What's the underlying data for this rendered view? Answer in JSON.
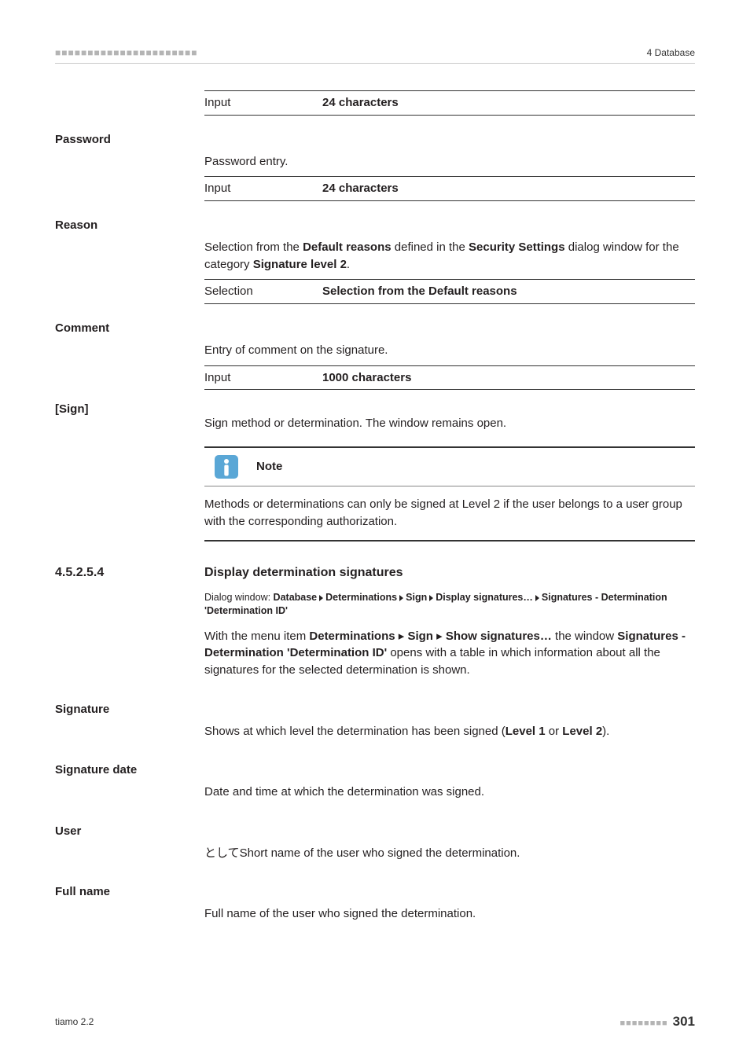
{
  "header": {
    "tick_pattern": "■■■■■■■■■■■■■■■■■■■■■■",
    "right": "4 Database"
  },
  "top_spec": {
    "key": "Input",
    "val": "24 characters"
  },
  "fields": {
    "password": {
      "label": "Password",
      "desc": "Password entry.",
      "spec_key": "Input",
      "spec_val": "24 characters"
    },
    "reason": {
      "label": "Reason",
      "desc_pre": "Selection from the ",
      "desc_bold1": "Default reasons",
      "desc_mid": " defined in the ",
      "desc_bold2": "Security Settings",
      "desc_after": " dialog window for the category ",
      "desc_bold3": "Signature level 2",
      "desc_end": ".",
      "spec_key": "Selection",
      "spec_val": "Selection from the Default reasons"
    },
    "comment": {
      "label": "Comment",
      "desc": "Entry of comment on the signature.",
      "spec_key": "Input",
      "spec_val": "1000 characters"
    },
    "sign": {
      "label": "[Sign]",
      "desc": "Sign method or determination. The window remains open."
    }
  },
  "note": {
    "title": "Note",
    "body": "Methods or determinations can only be signed at Level 2 if the user belongs to a user group with the corresponding authorization."
  },
  "section": {
    "number": "4.5.2.5.4",
    "title": "Display determination signatures",
    "dialog_prefix": "Dialog window: ",
    "dialog_parts": [
      "Database",
      "Determinations",
      "Sign",
      "Display signatures…",
      "Signatures - Determination 'Determination ID'"
    ],
    "body_pre": "With the menu item ",
    "body_bold1": "Determinations",
    "body_sep1": " ▸ ",
    "body_bold2": "Sign",
    "body_sep2": " ▸ ",
    "body_bold3": "Show signatures…",
    "body_mid": " the window ",
    "body_bold4": "Signatures - Determination 'Determination ID'",
    "body_after": " opens with a table in which information about all the signatures for the selected determination is shown."
  },
  "bottom_fields": {
    "signature": {
      "label": "Signature",
      "pre": "Shows at which level the determination has been signed (",
      "b1": "Level 1",
      "mid": " or ",
      "b2": "Level 2",
      "post": ")."
    },
    "sig_date": {
      "label": "Signature date",
      "desc": "Date and time at which the determination was signed."
    },
    "user": {
      "label": "User",
      "desc": "Short name of the user who signed the determination."
    },
    "full_name": {
      "label": "Full name",
      "desc": "Full name of the user who signed the determination."
    }
  },
  "footer": {
    "left": "tiamo 2.2",
    "dots": "■■■■■■■■",
    "page": "301"
  }
}
